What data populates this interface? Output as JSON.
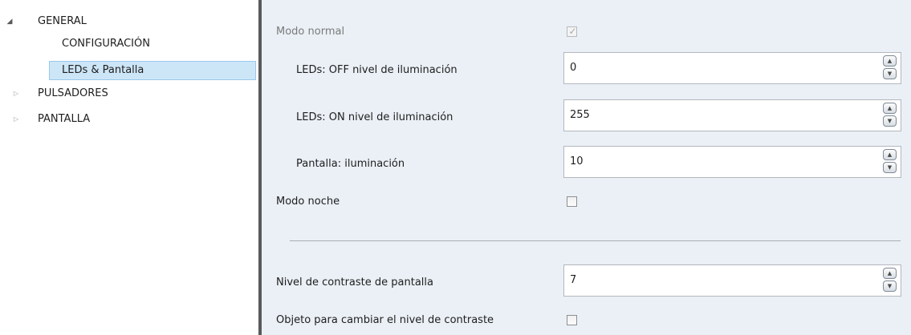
{
  "tree": {
    "items": [
      {
        "label": "GENERAL",
        "arrow": "expanded-arrow-icon"
      },
      {
        "label": "CONFIGURACIÓN"
      },
      {
        "label": "LEDs & Pantalla",
        "selected": true
      },
      {
        "label": "PULSADORES",
        "arrow": "collapsed-arrow-icon"
      },
      {
        "label": "PANTALLA",
        "arrow": "collapsed-arrow-icon"
      }
    ]
  },
  "params": {
    "modo_normal": {
      "label": "Modo normal",
      "checked": true,
      "enabled": false
    },
    "leds_off": {
      "label": "LEDs: OFF nivel de iluminación",
      "value": "0"
    },
    "leds_on": {
      "label": "LEDs: ON nivel de iluminación",
      "value": "255"
    },
    "pantalla_ilum": {
      "label": "Pantalla: iluminación",
      "value": "10"
    },
    "modo_noche": {
      "label": "Modo noche",
      "checked": false
    },
    "contraste": {
      "label": "Nivel de contraste de pantalla",
      "value": "7"
    },
    "objeto_contraste": {
      "label": "Objeto para cambiar el nivel de contraste",
      "checked": false
    }
  },
  "colors": {
    "selection_bg": "#cde6f7",
    "panel_bg": "#eaf0f6",
    "splitter": "#5a5a5a"
  }
}
